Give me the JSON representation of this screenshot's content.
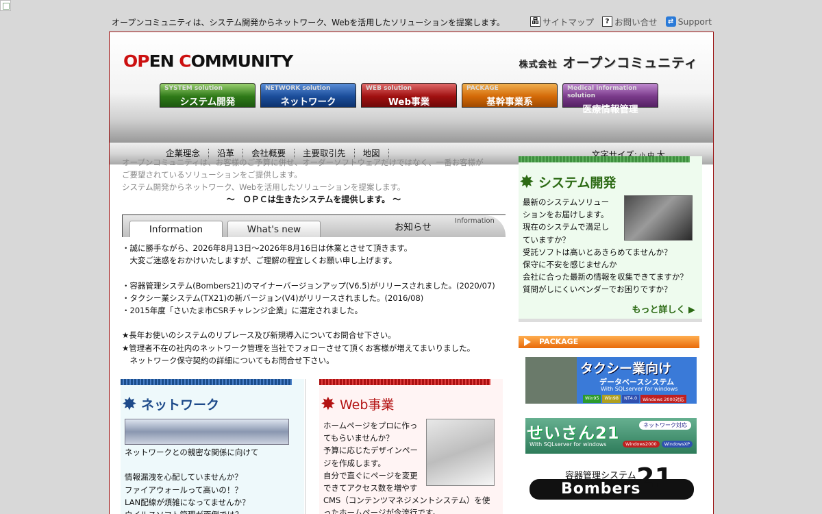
{
  "header": {
    "tagline": "オープンコミュニティは、システム開発からネットワーク、Webを活用したソリューションを提案します。",
    "links": {
      "sitemap": "サイトマップ",
      "contact": "お問い合せ",
      "support": "Support"
    },
    "logo": {
      "part1": "OP",
      "part2": "EN ",
      "part3": "C",
      "part4": "OMMUNITY"
    },
    "company_prefix": "株式会社",
    "company_name": "オープンコミュニティ"
  },
  "nav": [
    {
      "en": "SYSTEM solution",
      "jp": "システム開発"
    },
    {
      "en": "NETWORK solution",
      "jp": "ネットワーク"
    },
    {
      "en": "WEB solution",
      "jp": "Web事業"
    },
    {
      "en": "PACKAGE",
      "jp": "基幹事業系"
    },
    {
      "en": "Medical information solution",
      "jp": "医療情報管理"
    }
  ],
  "subnav": [
    "企業理念",
    "沿革",
    "会社概要",
    "主要取引先",
    "地図"
  ],
  "fontsize": {
    "label": "文字サイズ:",
    "small": "小",
    "medium": "中",
    "large": "大"
  },
  "intro": {
    "line1": "オープンコミュニティは、お客様のご予算に併せ、オーダーソフトウェアだけではなく、一番お客様が",
    "line2": "ご要望されているソリューションをご提供します。",
    "line3": "システム開発からネットワーク、Webを活用したソリューションを提案します。",
    "slogan": "～　ＯＰＣは生きたシステムを提供します。 ～"
  },
  "tabs": {
    "active": "Information",
    "inactive": "What's new",
    "title": "お知らせ",
    "title_en": "Information"
  },
  "news": "・誠に勝手ながら、2026年8月13日～2026年8月16日は休業とさせて頂きます。\n　大変ご迷惑をおかけいたしますが、ご理解の程宜しくお願い申し上げます。\n\n・容器管理システム(Bombers21)のマイナーバージョンアップ(V6.5)がリリースされました。(2020/07)\n・タクシー業システム(TX21)の新バージョン(V4)がリリースされました。(2016/08)\n・2015年度「さいたま市CSRチャレンジ企業」に選定されました。\n\n★長年お使いのシステムのリプレース及び新規導入についてお問合せ下さい。\n★管理者不在の社内のネットワーク管理を当社でフォローさせて頂くお客様が増えてまいりました。\n　ネットワーク保守契約の詳細についてもお問合せ下さい。",
  "system": {
    "title": "システム開発",
    "text": "最新のシステムソリュー\nションをお届けします。\n現在のシステムで満足し\nていますか？\n受託ソフトは高いとあきらめてませんか？\n保守に不安を感じませんか\n会社に合った最新の情報を収集できてますか？\n質問がしにくいベンダーでお困りですか？",
    "more": "もっと詳しく"
  },
  "package": {
    "header": "PACKAGE",
    "taxi": {
      "title": "タクシー業向け",
      "subtitle": "データベースシステム",
      "sub2": "With SQLserver for windows",
      "tags": [
        "Win95",
        "Win98",
        "NT4.0",
        "Windows 2000対応"
      ]
    },
    "seisan": {
      "title": "せいさん21",
      "sub": "With SQLserver for windows",
      "net": "ネットワーク対応",
      "tags": [
        "Windows2000",
        "WindowsXP"
      ]
    },
    "bombers": {
      "title": "容器管理システム",
      "name": "Bombers",
      "num": "21"
    }
  },
  "network": {
    "title": "ネットワーク",
    "text": "ネットワークとの親密な関係に向けて\n\n情報漏洩を心配していませんか？\nファイアウォールって高いの！？\nLAN配線が煩雑になってませんか？\nウイルスソフト管理が面倒では？"
  },
  "web": {
    "title": "Web事業",
    "text": "ホームページをプロに作っ\nてもらいませんか？\n予算に応じたデザインペー\nジを作成します。\n自分で直ぐにページを変更\nできてアクセス数を増やす\nCMS（コンテンツマネジメントシステム）を使\nったホームページが今流行です。"
  }
}
